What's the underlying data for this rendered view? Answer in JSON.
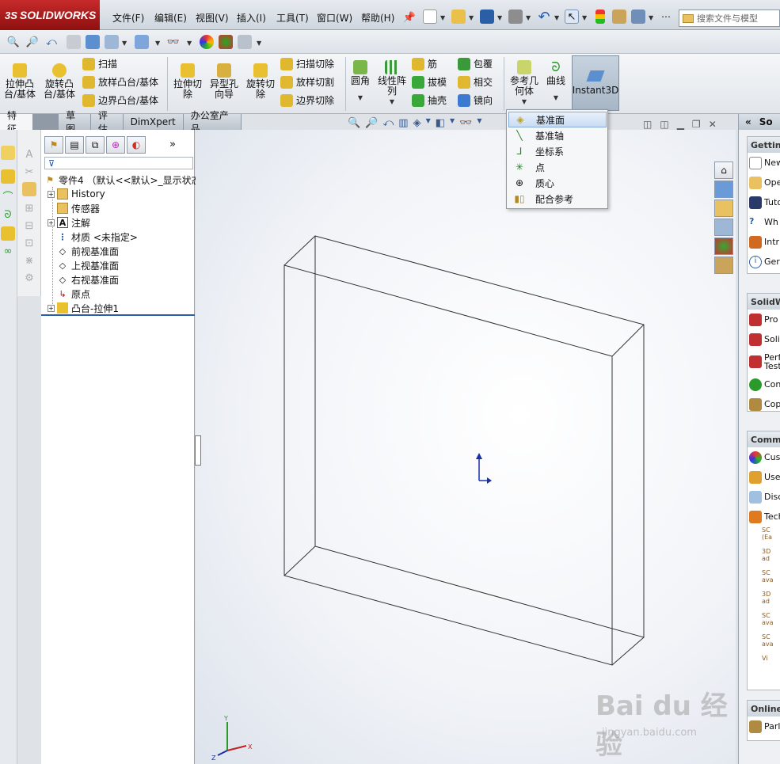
{
  "app": {
    "logo": "SOLIDWORKS",
    "logo_prefix": "3S"
  },
  "menu": [
    "文件(F)",
    "编辑(E)",
    "视图(V)",
    "插入(I)",
    "工具(T)",
    "窗口(W)",
    "帮助(H)"
  ],
  "search": {
    "placeholder": "搜索文件与模型"
  },
  "features": {
    "extrude_boss": "拉伸凸\n台/基体",
    "revolve_boss": "旋转凸\n台/基体",
    "sweep": "扫描",
    "loft_boss": "放样凸台/基体",
    "boundary_boss": "边界凸台/基体",
    "extrude_cut": "拉伸切\n除",
    "hole_wizard": "异型孔\n向导",
    "revolve_cut": "旋转切\n除",
    "sweep_cut": "扫描切除",
    "loft_cut": "放样切割",
    "boundary_cut": "边界切除",
    "fillet": "圆角",
    "linear_pattern": "线性阵\n列",
    "rib": "筋",
    "draft": "拔模",
    "shell": "抽壳",
    "wrap": "包覆",
    "intersect": "相交",
    "mirror": "镜向",
    "ref_geometry": "参考几\n何体",
    "curves": "曲线",
    "instant3d": "Instant3D"
  },
  "tabs": [
    "特征",
    "草图",
    "评估",
    "DimXpert",
    "办公室产品"
  ],
  "tree": {
    "root": "零件4 （默认<<默认>_显示状态",
    "items": [
      {
        "label": "History",
        "expand": "+"
      },
      {
        "label": "传感器",
        "expand": ""
      },
      {
        "label": "注解",
        "expand": "+"
      },
      {
        "label": "材质 <未指定>",
        "expand": ""
      },
      {
        "label": "前视基准面",
        "expand": ""
      },
      {
        "label": "上视基准面",
        "expand": ""
      },
      {
        "label": "右视基准面",
        "expand": ""
      },
      {
        "label": "原点",
        "expand": ""
      },
      {
        "label": "凸台-拉伸1",
        "expand": "+"
      }
    ]
  },
  "ref_menu": {
    "items": [
      "基准面",
      "基准轴",
      "坐标系",
      "点",
      "质心",
      "配合参考"
    ],
    "highlighted": 0
  },
  "taskpane": {
    "groups": [
      {
        "title": "Getting",
        "items": [
          "New",
          "Ope",
          "Tuto",
          "Wh",
          "Intr",
          "Ger"
        ]
      },
      {
        "title": "SolidW",
        "items": [
          "Pro",
          "Soli",
          "Perf\nTest",
          "Con",
          "Cop"
        ]
      },
      {
        "title": "Commu",
        "items": [
          "Cus",
          "Use",
          "Disc",
          "Tech"
        ]
      },
      {
        "title": "Online",
        "items": [
          "Parl"
        ]
      }
    ],
    "small_links": [
      "SC\n(Ea",
      "3D\nad",
      "SC\nava",
      "3D\nad",
      "SC\nava",
      "SC\nava"
    ],
    "view_link": "Vi"
  },
  "triad": {
    "x": "X",
    "y": "Y",
    "z": "Z"
  },
  "watermark": {
    "main": "Bai du 经验",
    "sub": "jingyan.baidu.com"
  },
  "colors": {
    "accent_red": "#b31b1b",
    "highlight": "#c9dcf4"
  }
}
